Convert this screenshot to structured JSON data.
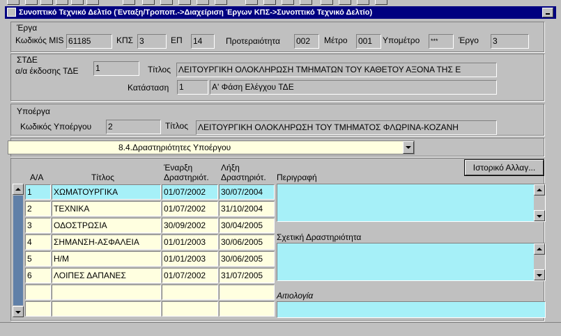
{
  "window": {
    "title": "Συνοπτικό Τεχνικό Δελτίο (Ένταξη/Τροποπ.->Διαχείριση Έργων ΚΠΣ->Συνοπτικό Τεχνικό Δελτίο)"
  },
  "erga": {
    "group_label": "Έργα",
    "mis_label": "Κωδικός MIS",
    "mis_value": "61185",
    "kps_label": "ΚΠΣ",
    "kps_value": "3",
    "ep_label": "ΕΠ",
    "ep_value": "14",
    "proteraiotita_label": "Προτεραιότητα",
    "proteraiotita_value": "002",
    "metro_label": "Μέτρο",
    "metro_value": "001",
    "ypometro_label": "Υπομέτρο",
    "ypometro_value": "***",
    "ergo_label": "Έργο",
    "ergo_value": "3"
  },
  "stde": {
    "group_label": "ΣΤΔΕ",
    "ekdosi_label": "α/α έκδοσης ΤΔΕ",
    "ekdosi_value": "1",
    "titlos_label": "Τίτλος",
    "titlos_value": "ΛΕΙΤΟΥΡΓΙΚΗ ΟΛΟΚΛΗΡΩΣΗ ΤΜΗΜΑΤΩΝ ΤΟΥ ΚΑΘΕΤΟΥ ΑΞΟΝΑ ΤΗΣ Ε",
    "katastasi_label": "Κατάσταση",
    "katastasi_code": "1",
    "katastasi_value": "Α' Φάση Ελέγχου ΤΔΕ"
  },
  "ypoerga": {
    "group_label": "Υποέργα",
    "kodikos_label": "Κωδικός Υποέργου",
    "kodikos_value": "2",
    "titlos_label": "Τίτλος",
    "titlos_value": "ΛΕΙΤΟΥΡΓΙΚΗ ΟΛΟΚΛΗΡΩΣΗ ΤΟΥ ΤΜΗΜΑΤΟΣ ΦΛΩΡΙΝΑ-ΚΟΖΑΝΗ"
  },
  "section_select": {
    "value": "8.4.Δραστηριότητες Υποέργου"
  },
  "history_button": "Ιστορικό Αλλαγ...",
  "grid": {
    "headers": {
      "aa": "Α/Α",
      "titlos": "Τίτλος",
      "enarxi": [
        "Έναρξη",
        "Δραστηριότ."
      ],
      "lixi": [
        "Λήξη",
        "Δραστηριότ."
      ]
    },
    "rows": [
      {
        "aa": "1",
        "titlos": "ΧΩΜΑΤΟΥΡΓΙΚΑ",
        "enarxi": "01/07/2002",
        "lixi": "30/07/2004"
      },
      {
        "aa": "2",
        "titlos": "ΤΕΧΝΙΚΑ",
        "enarxi": "01/07/2002",
        "lixi": "31/10/2004"
      },
      {
        "aa": "3",
        "titlos": "ΟΔΟΣΤΡΩΣΙΑ",
        "enarxi": "30/09/2002",
        "lixi": "30/04/2005"
      },
      {
        "aa": "4",
        "titlos": "ΣΗΜΑΝΣΗ-ΑΣΦΑΛΕΙΑ",
        "enarxi": "01/01/2003",
        "lixi": "30/06/2005"
      },
      {
        "aa": "5",
        "titlos": "Η/Μ",
        "enarxi": "01/01/2003",
        "lixi": "30/06/2005"
      },
      {
        "aa": "6",
        "titlos": "ΛΟΙΠΕΣ ΔΑΠΑΝΕΣ",
        "enarxi": "01/07/2002",
        "lixi": "31/07/2005"
      },
      {
        "aa": "",
        "titlos": "",
        "enarxi": "",
        "lixi": ""
      },
      {
        "aa": "",
        "titlos": "",
        "enarxi": "",
        "lixi": ""
      }
    ]
  },
  "perigrafi_label": "Περιγραφή",
  "sxetiki_label": "Σχετική  Δραστηριότητα",
  "aitiologia_label": "Αιτιολογία"
}
